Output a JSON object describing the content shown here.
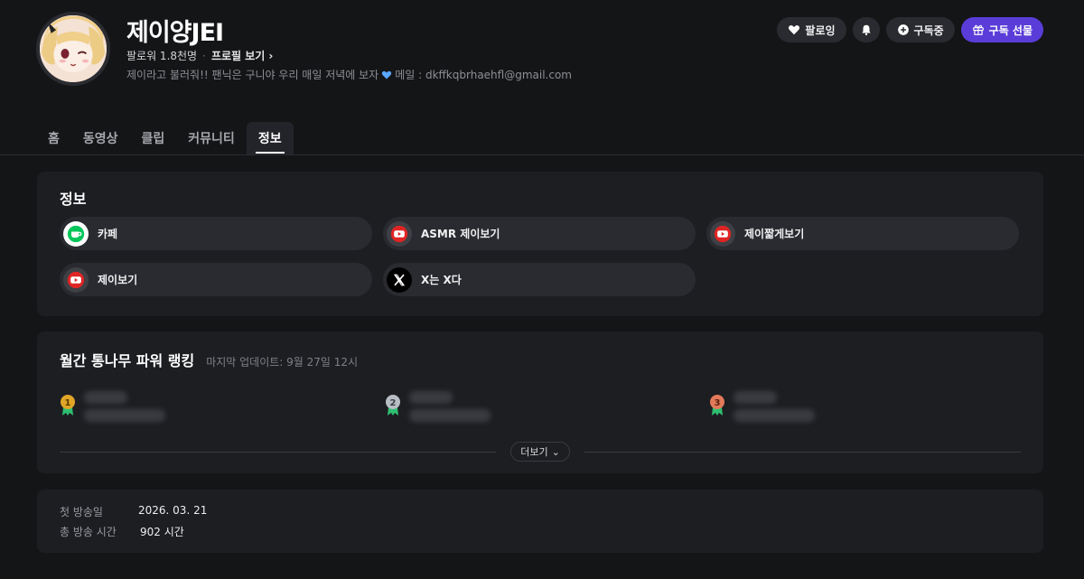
{
  "channel": {
    "name": "제이양JEI",
    "followers": "팔로워 1.8천명",
    "profile_link": "프로필 보기",
    "bio": "제이라고 불러줘!! 팬닉은 구니야 우리 매일 저녁에 보자",
    "email": "메일 : dkffkqbrhaehfl@gmail.com"
  },
  "actions": {
    "follow": "팔로잉",
    "subscribe": "구독중",
    "gift": "구독 선물"
  },
  "tabs": [
    {
      "label": "홈",
      "active": false
    },
    {
      "label": "동영상",
      "active": false
    },
    {
      "label": "클립",
      "active": false
    },
    {
      "label": "커뮤니티",
      "active": false
    },
    {
      "label": "정보",
      "active": true
    }
  ],
  "info": {
    "title": "정보",
    "links": [
      {
        "label": "카페",
        "icon": "cafe-icon"
      },
      {
        "label": "ASMR 제이보기",
        "icon": "youtube-icon"
      },
      {
        "label": "제이짧게보기",
        "icon": "youtube-icon"
      },
      {
        "label": "제이보기",
        "icon": "youtube-icon"
      },
      {
        "label": "X는 X다",
        "icon": "x-icon"
      }
    ]
  },
  "ranking": {
    "title": "월간 통나무 파워 랭킹",
    "updated": "마지막 업데이트: 9월 27일 12시",
    "ranks": [
      "1",
      "2",
      "3"
    ],
    "more": "더보기"
  },
  "stats": {
    "first_label": "첫 방송일",
    "first_value": "2026. 03. 21",
    "total_label": "총 방송 시간",
    "total_value": "902 시간"
  },
  "colors": {
    "accent": "#5a3dd8",
    "background": "#141517",
    "card": "#1d1e22"
  }
}
